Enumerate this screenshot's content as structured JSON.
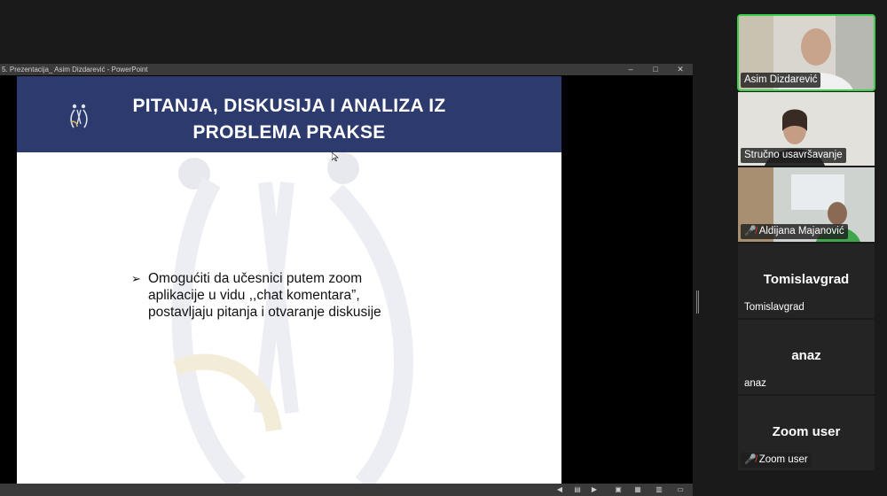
{
  "window": {
    "title": "5. Prezentacija_ Asim Dizdarević - PowerPoint",
    "minimize": "–",
    "maximize": "□",
    "close": "✕"
  },
  "slide": {
    "heading": "PITANJA, DISKUSIJA I ANALIZA IZ\nPROBLEMA PRAKSE",
    "bullet_marker": "➢",
    "bullet_text": "Omogućiti da učesnici putem zoom\naplikacije u vidu ,,chat komentara”,\npostavljaju pitanja i otvaranje diskusije"
  },
  "participants": [
    {
      "name": "Asim Dizdarević",
      "video": true,
      "muted": false,
      "active": true
    },
    {
      "name": "Stručno usavršavanje",
      "video": true,
      "muted": false,
      "active": false
    },
    {
      "name": "Aldijana Majanović",
      "video": true,
      "muted": true,
      "active": false
    },
    {
      "name": "Tomislavgrad",
      "display": "Tomislavgrad",
      "video": false,
      "muted": false
    },
    {
      "name": "anaz",
      "display": "anaz",
      "video": false,
      "muted": false
    },
    {
      "name": "Zoom user",
      "display": "Zoom user",
      "video": false,
      "muted": true
    }
  ],
  "colors": {
    "banner": "#2d3a6d",
    "active_speaker": "#3ccf4e",
    "muted_icon": "#e53935"
  }
}
